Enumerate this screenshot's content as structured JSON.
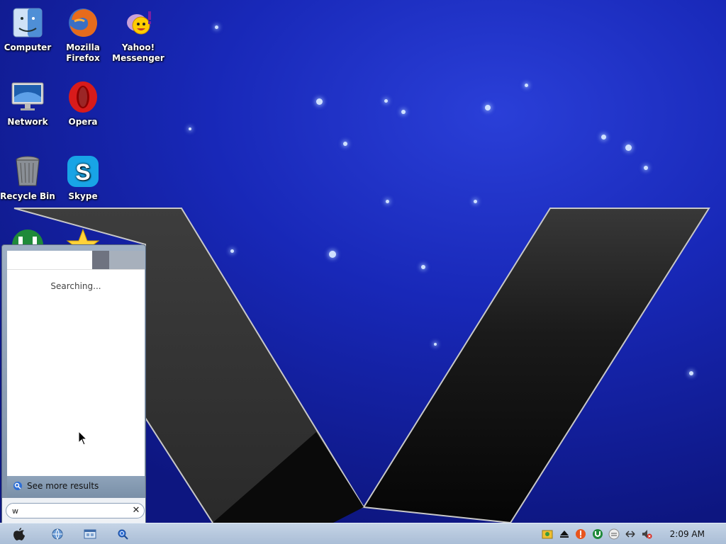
{
  "desktop": {
    "icons": [
      {
        "label_line1": "Computer",
        "label_line2": "",
        "icon": "finder-icon"
      },
      {
        "label_line1": "Mozilla",
        "label_line2": "Firefox",
        "icon": "firefox-icon"
      },
      {
        "label_line1": "Yahoo!",
        "label_line2": "Messenger",
        "icon": "yahoo-messenger-icon"
      },
      {
        "label_line1": "Network",
        "label_line2": "",
        "icon": "monitor-icon"
      },
      {
        "label_line1": "Opera",
        "label_line2": "",
        "icon": "opera-icon"
      },
      {
        "label_line1": "Recycle Bin",
        "label_line2": "",
        "icon": "trash-icon"
      },
      {
        "label_line1": "Skype",
        "label_line2": "",
        "icon": "skype-icon"
      },
      {
        "label_line1": "",
        "label_line2": "",
        "icon": "utorrent-icon"
      },
      {
        "label_line1": "",
        "label_line2": "",
        "icon": "star-icon"
      }
    ]
  },
  "start_menu": {
    "status_text": "Searching...",
    "see_more": "See more results",
    "search_value": "w"
  },
  "taskbar": {
    "start_icon": "apple-icon",
    "pinned": [
      "browser-icon",
      "explorer-icon",
      "search-icon"
    ],
    "tray": [
      "app-icon",
      "eject-icon",
      "alert-icon",
      "utorrent-icon",
      "volume-mixer-icon",
      "network-icon",
      "volume-muted-icon"
    ],
    "clock": "2:09 AM"
  },
  "colors": {
    "wallpaper": "#1828b8",
    "taskbar": "#b7c9de",
    "v_logo": "#3a3a3a"
  }
}
